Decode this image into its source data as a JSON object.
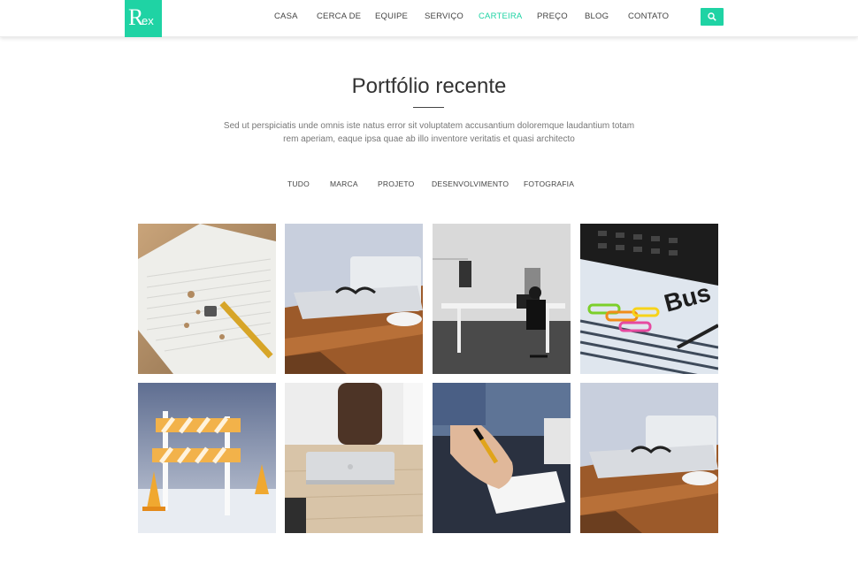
{
  "brand": {
    "logo_big": "R",
    "logo_small": "ex",
    "accent": "#1fd3a4"
  },
  "nav": {
    "items": [
      "CASA",
      "CERCA DE",
      "EQUIPE",
      "SERVIÇO",
      "CARTEIRA",
      "PREÇO",
      "BLOG",
      "CONTATO"
    ],
    "active": "CARTEIRA"
  },
  "search": {
    "icon": "search-icon"
  },
  "portfolio": {
    "title": "Portfólio recente",
    "description_line1": "Sed ut perspiciatis unde omnis iste natus error sit voluptatem accusantium doloremque laudantium totam",
    "description_line2": "rem aperiam, eaque ipsa quae ab illo inventore veritatis et quasi architecto",
    "filters": [
      "TUDO",
      "MARCA",
      "PROJETO",
      "DESENVOLVIMENTO",
      "FOTOGRAFIA"
    ],
    "items": [
      "notebook-pencil-photo",
      "laptop-glasses-desk-photo",
      "office-workspace-photo",
      "calculator-paperclips-photo",
      "construction-barrier-photo",
      "laptop-on-wood-photo",
      "hand-writing-photo",
      "laptop-glasses-desk-photo"
    ]
  }
}
